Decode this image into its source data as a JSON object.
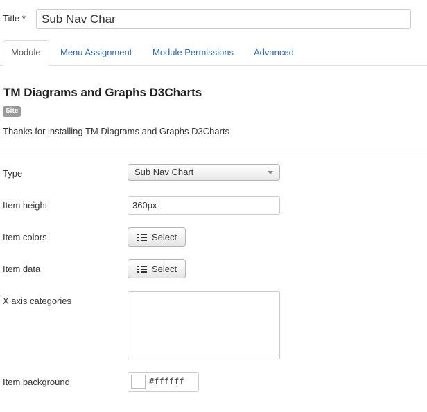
{
  "title_field": {
    "label": "Title *",
    "value": "Sub Nav Char"
  },
  "tabs": [
    {
      "label": "Module",
      "active": true
    },
    {
      "label": "Menu Assignment",
      "active": false
    },
    {
      "label": "Module Permissions",
      "active": false
    },
    {
      "label": "Advanced",
      "active": false
    }
  ],
  "module": {
    "heading": "TM Diagrams and Graphs D3Charts",
    "badge": "Site",
    "description": "Thanks for installing TM Diagrams and Graphs D3Charts"
  },
  "fields": {
    "type": {
      "label": "Type",
      "value": "Sub Nav Chart"
    },
    "item_height": {
      "label": "Item height",
      "value": "360px"
    },
    "item_colors": {
      "label": "Item colors",
      "button": "Select",
      "icon": "list-icon"
    },
    "item_data": {
      "label": "Item data",
      "button": "Select",
      "icon": "list-icon"
    },
    "x_axis_categories": {
      "label": "X axis categories",
      "value": ""
    },
    "item_background": {
      "label": "Item background",
      "value": "#ffffff"
    }
  },
  "colors": {
    "link": "#2a69b8",
    "badge_bg": "#999999",
    "swatch": "#ffffff"
  }
}
